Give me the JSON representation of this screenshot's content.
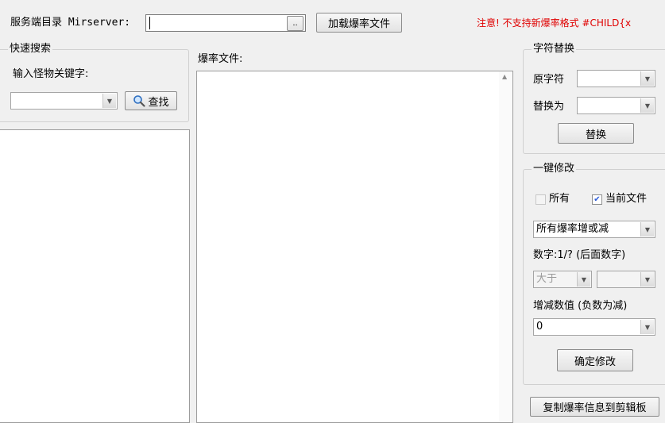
{
  "top": {
    "server_dir_label": "服务端目录 Mirserver:",
    "server_dir_value": "",
    "browse_label": "..",
    "load_button": "加载爆率文件",
    "notice": "注意! 不支持新爆率格式 #CHILD{x"
  },
  "quick_search": {
    "legend": "快速搜索",
    "keyword_label": "输入怪物关键字:",
    "keyword_value": "",
    "search_button": "查找",
    "search_icon": "magnifier-icon"
  },
  "drop_file": {
    "label": "爆率文件:"
  },
  "replace": {
    "legend": "字符替换",
    "original_label": "原字符",
    "original_value": "",
    "replace_with_label": "替换为",
    "replace_with_value": "",
    "replace_button": "替换"
  },
  "batch": {
    "legend": "一键修改",
    "all_label": "所有",
    "all_checked": false,
    "current_label": "当前文件",
    "current_checked": true,
    "mode_value": "所有爆率增或减",
    "number_label": "数字:1/? (后面数字)",
    "compare_value": "大于",
    "compare_number_value": "",
    "delta_label": "增减数值 (负数为减)",
    "delta_value": "0",
    "confirm_button": "确定修改"
  },
  "copy_button": "复制爆率信息到剪辑板"
}
